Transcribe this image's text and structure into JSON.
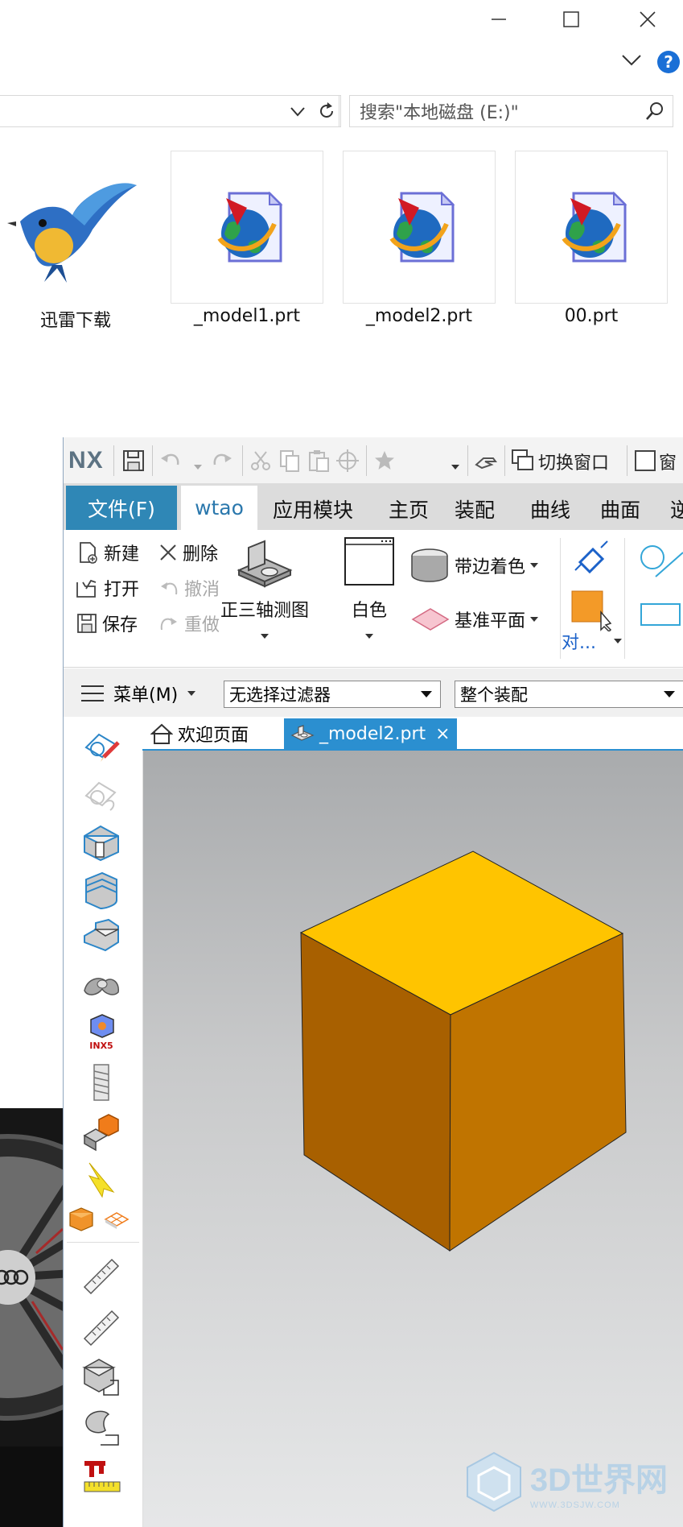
{
  "explorer": {
    "window_controls": [
      "minimize-icon",
      "maximize-icon",
      "close-icon"
    ],
    "help_label": "?",
    "search_placeholder": "搜索\"本地磁盘 (E:)\"",
    "items": [
      {
        "name": "迅雷下载",
        "icon": "thunder-bird-icon"
      },
      {
        "name": "_model1.prt",
        "icon": "nx-part-file-icon"
      },
      {
        "name": "_model2.prt",
        "icon": "nx-part-file-icon"
      },
      {
        "name": "00.prt",
        "icon": "nx-part-file-icon"
      }
    ]
  },
  "nx": {
    "logo": "NX",
    "qat": {
      "switch_window": "切换窗口",
      "window": "窗"
    },
    "menu": {
      "file": "文件(F)",
      "tabs": [
        "wtao",
        "应用模块",
        "主页",
        "装配",
        "曲线",
        "曲面",
        "逆"
      ]
    },
    "ribbon": {
      "new": "新建",
      "delete": "删除",
      "open": "打开",
      "undo": "撤消",
      "save": "保存",
      "redo": "重做",
      "view_orient": "正三轴测图",
      "background": "白色",
      "render_style": "带边着色",
      "datum_plane": "基准平面",
      "object_short": "对..."
    },
    "filterbar": {
      "menu": "菜单(M)",
      "filter": "无选择过滤器",
      "scope": "整个装配"
    },
    "doc_tabs": [
      {
        "label": "欢迎页面",
        "active": false
      },
      {
        "label": "_model2.prt",
        "active": true,
        "close": "×"
      }
    ],
    "left_tools": [
      "sketch-icon",
      "sketch-disabled-icon",
      "extrude-icon",
      "revolve-icon",
      "hole-icon",
      "pipe-icon",
      "inx5-icon",
      "thread-icon",
      "block-feature-icon",
      "lightning-icon",
      "cube-small-icon",
      "mesh-icon",
      "ruler-icon",
      "ruler-2-icon",
      "measure-body-icon",
      "measure-face-icon",
      "caliper-icon"
    ],
    "inx5_label": "INX5",
    "model_colors": {
      "top": "#ffc400",
      "left": "#a86000",
      "right": "#c07400"
    }
  },
  "watermark": {
    "text": "3D世界网",
    "sub": "WWW.3DSJW.COM"
  }
}
